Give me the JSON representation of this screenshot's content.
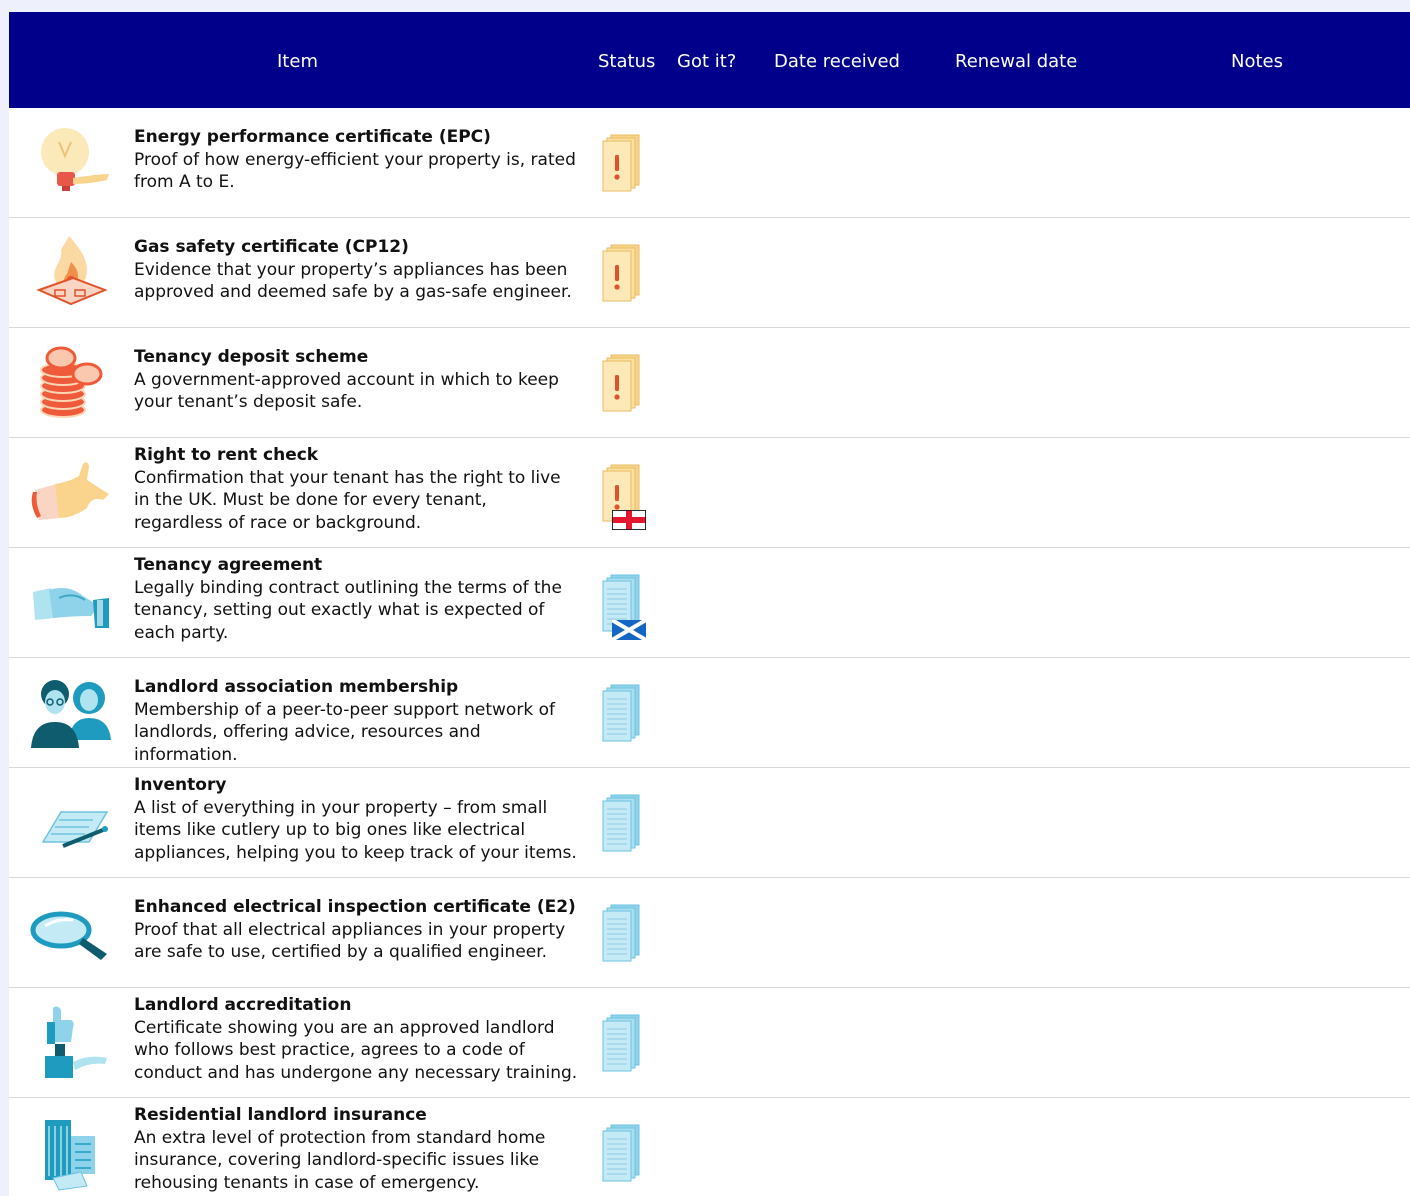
{
  "header": {
    "item": "Item",
    "status": "Status",
    "got_it": "Got it?",
    "date_received": "Date received",
    "renewal_date": "Renewal date",
    "notes": "Notes"
  },
  "colors": {
    "header_bg": "#00008b",
    "warning_paper": "#fde3a7",
    "warning_mark": "#e0532c",
    "ok_paper": "#a9dff0"
  },
  "rows": [
    {
      "title": "Energy performance certificate (EPC)",
      "desc": "Proof of how energy-efficient your property is, rated from A to E.",
      "icon": "lightbulb-icon",
      "status": "warning",
      "flag": ""
    },
    {
      "title": "Gas safety certificate (CP12)",
      "desc": "Evidence that your property’s appliances has been approved and deemed safe by a gas-safe engineer.",
      "icon": "gas-flame-icon",
      "status": "warning",
      "flag": ""
    },
    {
      "title": "Tenancy deposit scheme",
      "desc": "A government-approved account in which to keep your tenant’s deposit safe.",
      "icon": "coins-icon",
      "status": "warning",
      "flag": ""
    },
    {
      "title": "Right to rent check",
      "desc": "Confirmation that your tenant has the right to live in the UK. Must be done for every tenant, regardless of race or background.",
      "icon": "hand-icon",
      "status": "warning",
      "flag": "england-flag-icon"
    },
    {
      "title": "Tenancy agreement",
      "desc": "Legally binding contract outlining the terms of the tenancy, setting out exactly what is expected of each party.",
      "icon": "handshake-icon",
      "status": "ok",
      "flag": "scotland-flag-icon"
    },
    {
      "title": "Landlord association membership",
      "desc": "Membership of a peer-to-peer support network of landlords, offering advice, resources and information.",
      "icon": "people-icon",
      "status": "ok",
      "flag": ""
    },
    {
      "title": "Inventory",
      "desc": "A list of everything in your property – from small items like cutlery up to big ones like electrical appliances, helping you to keep track of your items.",
      "icon": "checklist-icon",
      "status": "ok",
      "flag": ""
    },
    {
      "title": "Enhanced electrical inspection certificate (E2)",
      "desc": "Proof that all electrical appliances in your property are safe to use, certified by a qualified engineer.",
      "icon": "magnifier-icon",
      "status": "ok",
      "flag": ""
    },
    {
      "title": "Landlord accreditation",
      "desc": "Certificate showing you are an approved landlord who follows best practice, agrees to a code of conduct and has undergone any necessary training.",
      "icon": "thumbs-up-icon",
      "status": "ok",
      "flag": ""
    },
    {
      "title": "Residential landlord insurance",
      "desc": "An extra level of protection from standard home insurance, covering landlord-specific issues like rehousing tenants in case of emergency.",
      "icon": "buildings-icon",
      "status": "ok",
      "flag": ""
    }
  ]
}
